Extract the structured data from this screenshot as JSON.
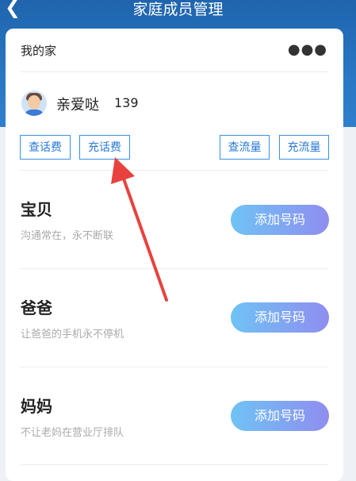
{
  "header": {
    "title": "家庭成员管理",
    "back_icon": "back-chevron-icon"
  },
  "family": {
    "name": "我的家",
    "more_icon": "more-dots-icon"
  },
  "user": {
    "name": "亲爱哒",
    "number": "139"
  },
  "actions": {
    "check_balance": "查话费",
    "recharge_balance": "充话费",
    "check_data": "查流量",
    "recharge_data": "充流量"
  },
  "members": [
    {
      "name": "宝贝",
      "desc": "沟通常在，永不断联",
      "button": "添加号码"
    },
    {
      "name": "爸爸",
      "desc": "让爸爸的手机永不停机",
      "button": "添加号码"
    },
    {
      "name": "妈妈",
      "desc": "不让老妈在营业厅排队",
      "button": "添加号码"
    }
  ],
  "colors": {
    "header_bg": "#1f64ad",
    "accent": "#2a7ad6",
    "arrow": "#e8423f"
  }
}
